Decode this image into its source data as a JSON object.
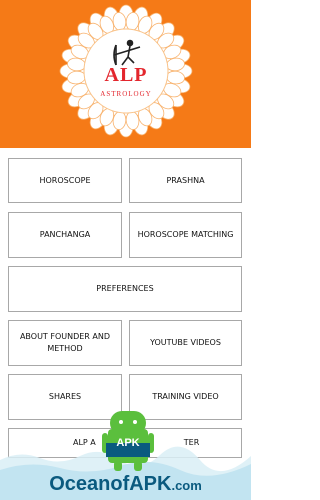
{
  "header": {
    "logo_title": "ALP",
    "logo_subtitle": "ASTROLOGY",
    "background_color": "#f57a17",
    "logo_color": "#e3262d"
  },
  "menu": {
    "horoscope": "HOROSCOPE",
    "prashna": "PRASHNA",
    "panchanga": "PANCHANGA",
    "horoscope_matching": "HOROSCOPE MATCHING",
    "preferences": "PREFERENCES",
    "about_founder": "ABOUT FOUNDER AND METHOD",
    "youtube_videos": "YOUTUBE VIDEOS",
    "shares": "SHARES",
    "training_video": "TRAINING VIDEO",
    "alp_astro_partial": "ALP A",
    "alp_astro_partial_right": "TER"
  },
  "watermark": {
    "badge": "APK",
    "site_main": "OceanofAPK",
    "site_tld": ".com",
    "icon": "android-robot-icon"
  }
}
